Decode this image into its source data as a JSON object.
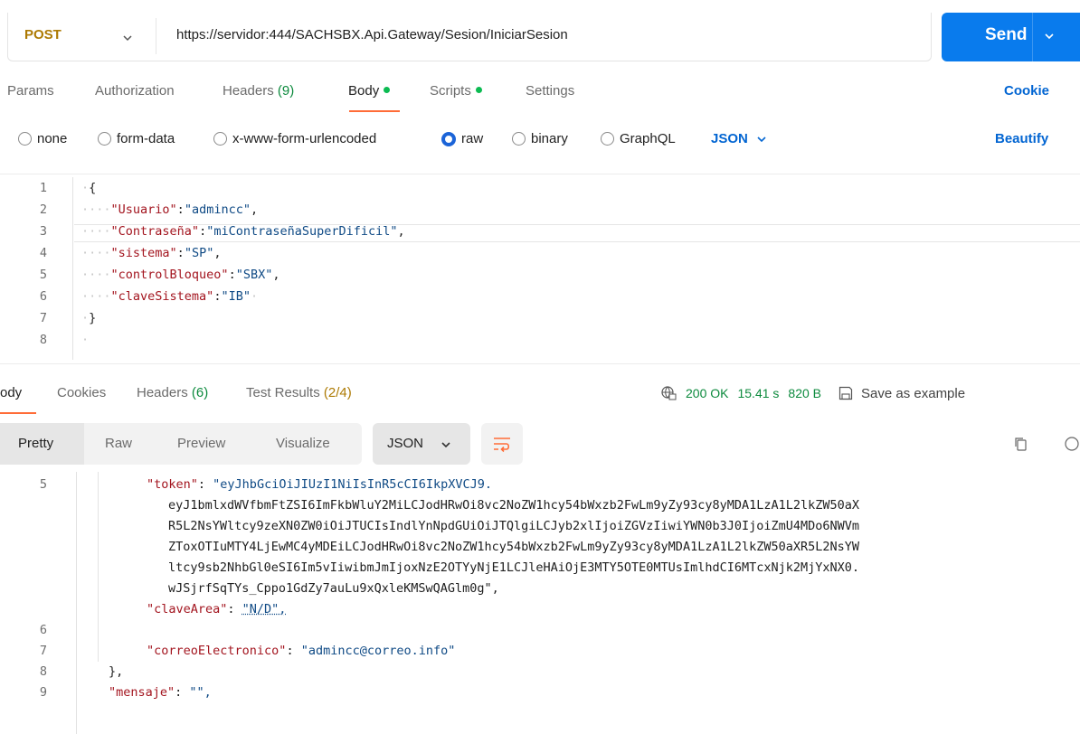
{
  "request": {
    "method": "POST",
    "url": "https://servidor:444/SACHSBX.Api.Gateway/Sesion/IniciarSesion",
    "send_label": "Send"
  },
  "request_tabs": [
    {
      "label": "Params"
    },
    {
      "label": "Authorization"
    },
    {
      "label": "Headers",
      "count": "(9)"
    },
    {
      "label": "Body"
    },
    {
      "label": "Scripts"
    },
    {
      "label": "Settings"
    }
  ],
  "cookies_label": "Cookie",
  "body_types": [
    "none",
    "form-data",
    "x-www-form-urlencoded",
    "raw",
    "binary",
    "GraphQL"
  ],
  "body_selected": "raw",
  "body_format": "JSON",
  "beautify_label": "Beautify",
  "request_body": {
    "line_numbers": [
      "1",
      "2",
      "3",
      "4",
      "5",
      "6",
      "7",
      "8"
    ],
    "fields": [
      {
        "key": "\"Usuario\"",
        "value": "\"admincc\""
      },
      {
        "key": "\"Contraseña\"",
        "value": "\"miContraseñaSuperDificil\""
      },
      {
        "key": "\"sistema\"",
        "value": "\"SP\""
      },
      {
        "key": "\"controlBloqueo\"",
        "value": "\"SBX\""
      },
      {
        "key": "\"claveSistema\"",
        "value": "\"IB\""
      }
    ]
  },
  "response_tabs": [
    {
      "label": "ody"
    },
    {
      "label": "Cookies"
    },
    {
      "label": "Headers",
      "count": "(6)"
    },
    {
      "label": "Test Results",
      "count": "(2/4)"
    }
  ],
  "response_status": {
    "status": "200 OK",
    "time": "15.41 s",
    "size": "820 B",
    "save_label": "Save as example"
  },
  "response_views": [
    "Pretty",
    "Raw",
    "Preview",
    "Visualize"
  ],
  "response_format": "JSON",
  "response_body": {
    "token_line_no": "5",
    "token_key": "\"token\"",
    "token_lines": [
      "\"eyJhbGciOiJIUzI1NiIsInR5cCI6IkpXVCJ9.",
      "eyJ1bmlxdWVfbmFtZSI6ImFkbWluY2MiLCJodHRwOi8vc2NoZW1hcy54bWxzb2FwLm9yZy93cy8yMDA1LzA1L2lkZW50aX",
      "R5L2NsYWltcy9zeXN0ZW0iOiJTUCIsIndlYnNpdGUiOiJTQlgiLCJyb2xlIjoiZGVzIiwiYWN0b3J0IjoiZmU4MDo6NWVm",
      "ZToxOTIuMTY4LjEwMC4yMDEiLCJodHRwOi8vc2NoZW1hcy54bWxzb2FwLm9yZy93cy8yMDA1LzA1L2lkZW50aXR5L2NsYW",
      "ltcy9sb2NhbGl0eSI6Im5vIiwibmJmIjoxNzE2OTYyNjE1LCJleHAiOjE3MTY5OTE0MTUsImlhdCI6MTcxNjk2MjYxNX0.",
      "wJSjrfSqTYs_Cppo1GdZy7auLu9xQxleKMSwQAGlm0g\","
    ],
    "rows": [
      {
        "no": "6",
        "key": "\"claveArea\"",
        "value": "\"N/D\","
      },
      {
        "no": "7",
        "key": "\"correoElectronico\"",
        "value": "\"admincc@correo.info\""
      },
      {
        "no": "8",
        "text": "},"
      },
      {
        "no": "9",
        "key": "\"mensaje\"",
        "value": "\"\","
      }
    ]
  }
}
